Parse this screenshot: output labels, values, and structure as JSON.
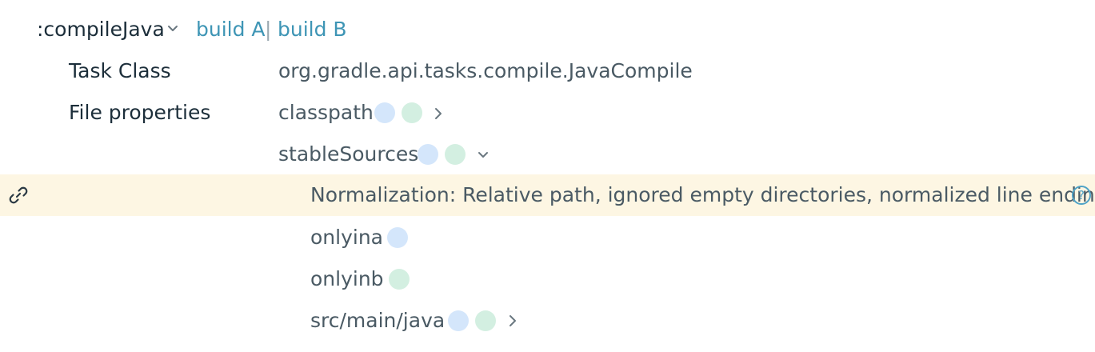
{
  "task": {
    "name": ":compileJava",
    "build_a": "build A",
    "separator": "|",
    "build_b": "build B"
  },
  "task_class": {
    "label": "Task Class",
    "value": "org.gradle.api.tasks.compile.JavaCompile"
  },
  "file_properties": {
    "label": "File properties",
    "items": [
      {
        "name": "classpath",
        "in_a": true,
        "in_b": true,
        "chevron": "chevron-right-icon"
      },
      {
        "name": "stableSources",
        "in_a": true,
        "in_b": true,
        "chevron": "chevron-down-icon"
      }
    ]
  },
  "normalization": {
    "text": "Normalization: Relative path, ignored empty directories, normalized line endings",
    "help_glyph": "?",
    "link_icon": "link-icon"
  },
  "children": [
    {
      "name": "onlyina",
      "in_a": true,
      "in_b": false
    },
    {
      "name": "onlyinb",
      "in_a": false,
      "in_b": true
    },
    {
      "name": "src/main/java",
      "in_a": true,
      "in_b": true,
      "chevron": "chevron-right-icon"
    }
  ],
  "colors": {
    "build_a_dot": "#d4e6fb",
    "build_b_dot": "#d3efe1",
    "link_blue": "#3e95b5",
    "highlight": "#fdf6e3"
  }
}
